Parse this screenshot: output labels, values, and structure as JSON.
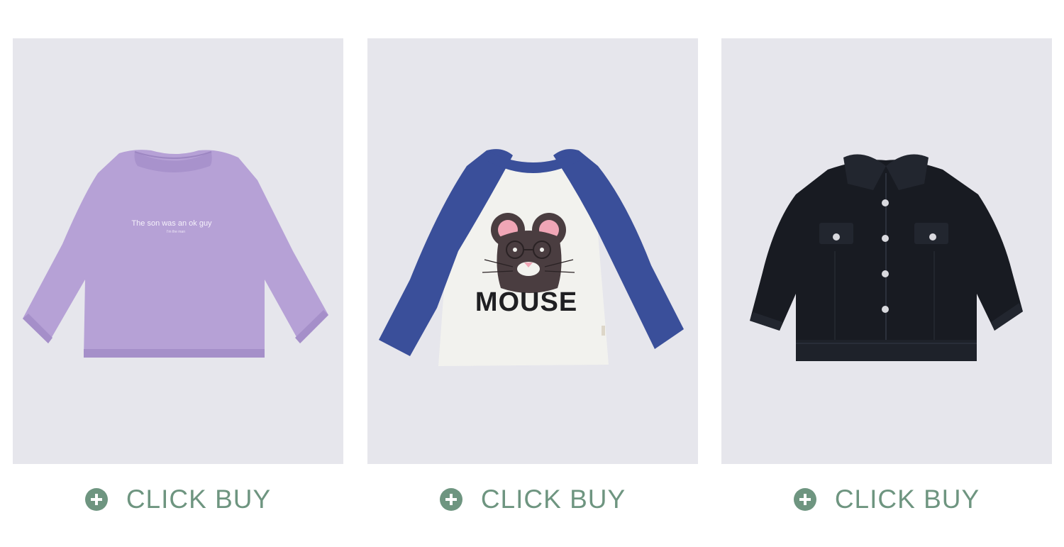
{
  "theme": {
    "accent": "#6e9580",
    "card_bg": "#e6e6ec"
  },
  "products": [
    {
      "image_name": "purple-long-sleeve-tee-image",
      "print_text": "The son was an ok guy",
      "print_subtext": "I'm the man",
      "buy_label": "CLICK BUY",
      "buy_icon": "plus-circle-icon"
    },
    {
      "image_name": "mouse-raglan-tee-image",
      "print_text": "MOUSE",
      "buy_label": "CLICK BUY",
      "buy_icon": "plus-circle-icon"
    },
    {
      "image_name": "black-denim-jacket-image",
      "buy_label": "CLICK BUY",
      "buy_icon": "plus-circle-icon"
    }
  ]
}
